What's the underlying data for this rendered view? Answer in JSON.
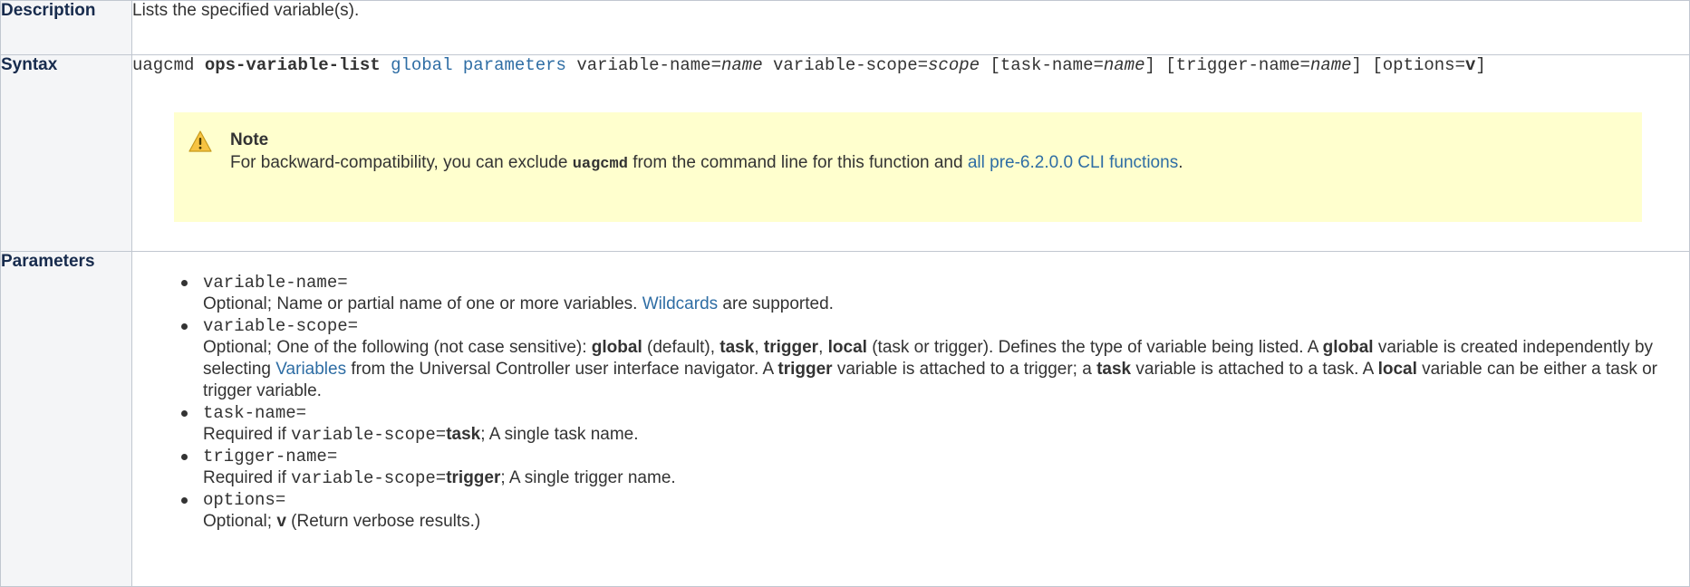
{
  "description": {
    "header": "Description",
    "text": "Lists the specified variable(s)."
  },
  "syntax": {
    "header": "Syntax",
    "cmd": "uagcmd",
    "function": "ops-variable-list",
    "global_link": "global",
    "parameters_link": "parameters",
    "p1": "variable-name=",
    "p1_val": "name",
    "p2": "variable-scope=",
    "p2_val": "scope",
    "p3": "[task-name=",
    "p3_val": "name",
    "p3_close": "]",
    "p4": "[trigger-name=",
    "p4_val": "name",
    "p4_close": "]",
    "p5": "[options=",
    "p5_val": "v",
    "p5_close": "]"
  },
  "note": {
    "title": "Note",
    "pre": "For backward-compatibility, you can exclude",
    "code": "uagcmd",
    "mid": "from the command line for this function and",
    "link": "all pre-6.2.0.0 CLI functions",
    "end": ".",
    "icon": "warning-icon"
  },
  "parameters": {
    "header": "Parameters",
    "items": [
      {
        "name": "variable-name=",
        "desc_pre": "Optional; Name or partial name of one or more variables. ",
        "desc_link": "Wildcards",
        "desc_post": " are supported."
      },
      {
        "name": "variable-scope=",
        "a": "Optional; One of the following (not case sensitive): ",
        "global": "global",
        "b": " (default), ",
        "task": "task",
        "c": ", ",
        "trigger": "trigger",
        "d": ", ",
        "local": "local",
        "e": " (task or trigger). Defines the type of variable being listed. A ",
        "global2": "global",
        "f": " variable is created independently by selecting ",
        "variables_link": "Variables",
        "g": " from the Universal Controller user interface navigator. A ",
        "trigger2": "trigger",
        "h": " variable is attached to a trigger; a ",
        "task2": "task",
        "i": " variable is attached to a task. A ",
        "local2": "local",
        "j": " variable can be either a task or trigger variable."
      },
      {
        "name": "task-name=",
        "pre": "Required if ",
        "code": "variable-scope=",
        "bold": "task",
        "post": "; A single task name."
      },
      {
        "name": "trigger-name=",
        "pre": "Required if ",
        "code": "variable-scope=",
        "bold": "trigger",
        "post": "; A single trigger name."
      },
      {
        "name": "options=",
        "pre": "Optional; ",
        "bold": "v",
        "post": " (Return verbose results.)"
      }
    ]
  },
  "colors": {
    "link": "#2e6da4",
    "note_bg": "#ffffce",
    "header_bg": "#f4f5f7",
    "border": "#c1c7d0"
  }
}
